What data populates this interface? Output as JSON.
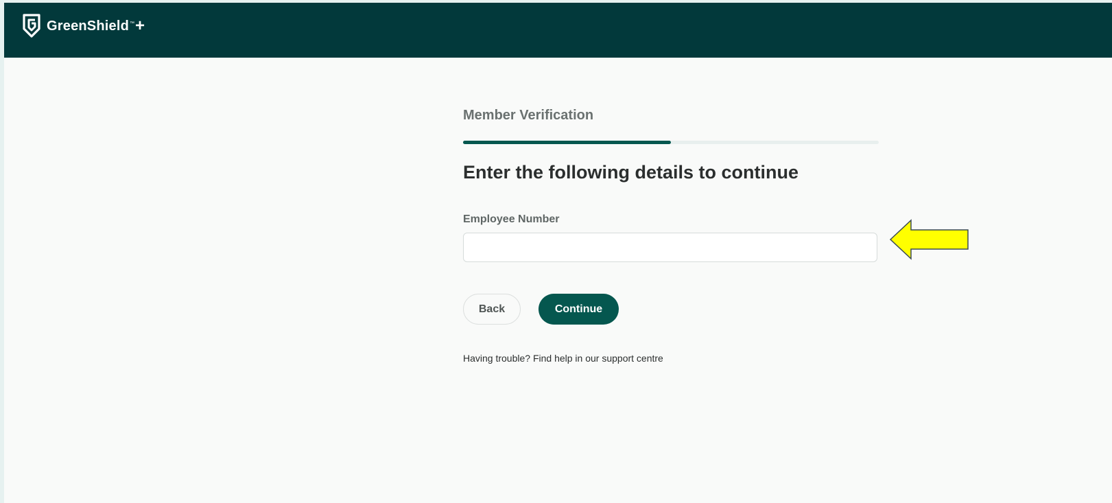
{
  "header": {
    "brand_name": "GreenShield",
    "brand_tm": "™",
    "brand_plus": "+",
    "background": "#02393b"
  },
  "verification": {
    "step_title": "Member Verification",
    "progress_fraction": 0.5,
    "heading": "Enter the following details to continue",
    "employee_number_label": "Employee Number",
    "employee_number_value": "",
    "back_label": "Back",
    "continue_label": "Continue",
    "help_text": "Having trouble? Find help in our support centre"
  },
  "colors": {
    "brand_dark": "#02393b",
    "accent": "#05574f",
    "annotation_arrow": "#ffff00"
  },
  "icons": {
    "logo": "greenshield-logo-icon",
    "annotation": "yellow-arrow-left-icon"
  }
}
